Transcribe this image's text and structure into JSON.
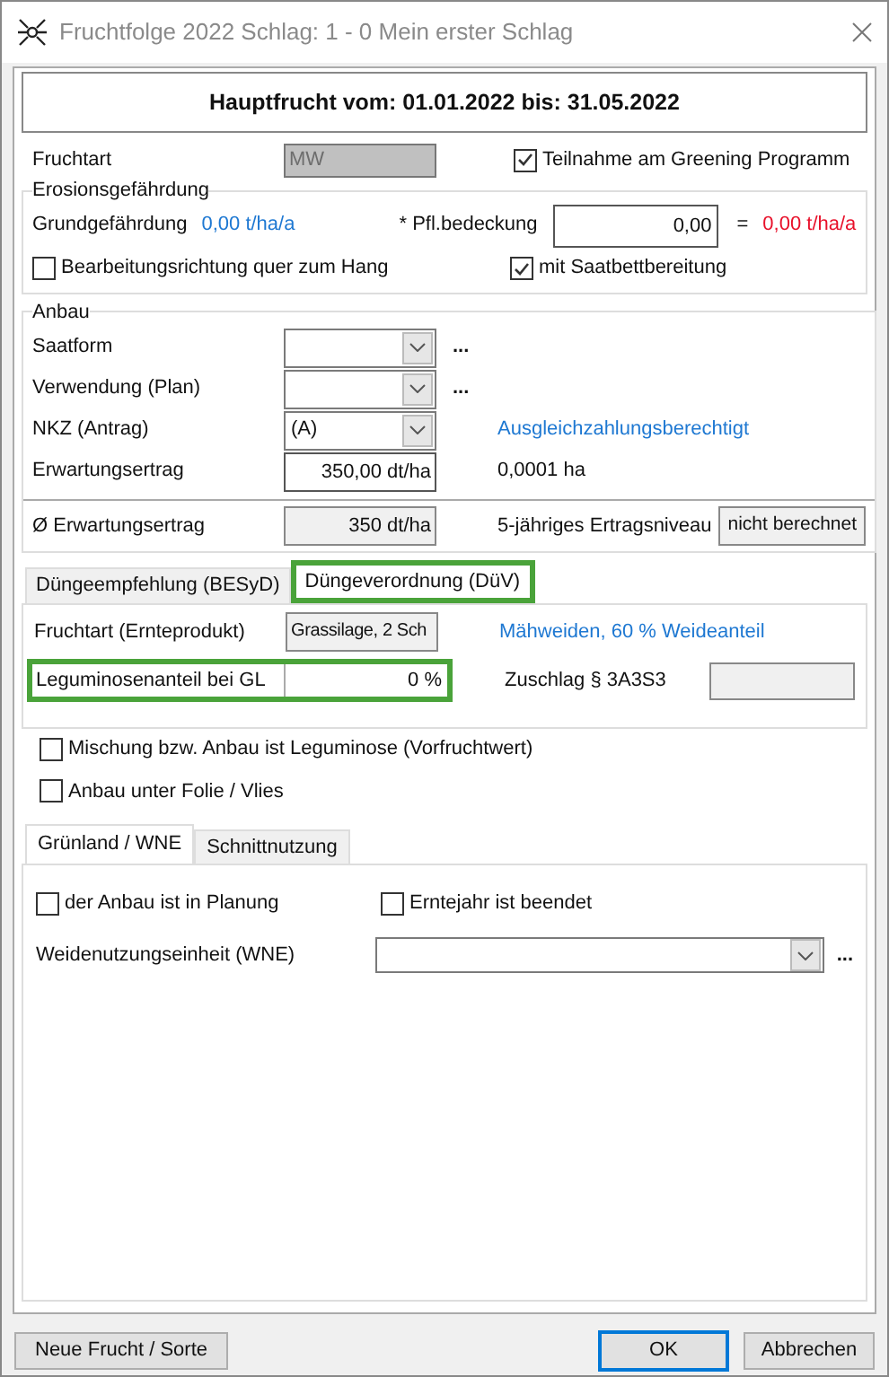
{
  "window": {
    "title": "Fruchtfolge 2022 Schlag: 1 - 0 Mein erster Schlag"
  },
  "header": "Hauptfrucht vom: 01.01.2022 bis: 31.05.2022",
  "fruchtart": {
    "label": "Fruchtart",
    "value": "MW",
    "disabled": true
  },
  "greening": {
    "label": "Teilnahme am Greening Programm",
    "checked": true
  },
  "erosion": {
    "legend": "Erosionsgefährdung",
    "grund_label": "Grundgefährdung",
    "grund_value": "0,00 t/ha/a",
    "pfl_label": "* Pfl.bedeckung",
    "pfl_value": "0,00",
    "equals": "=",
    "result": "0,00 t/ha/a",
    "checks": [
      {
        "label": "Bearbeitungsrichtung quer zum Hang",
        "checked": false
      },
      {
        "label": "mit Saatbettbereitung",
        "checked": true
      }
    ]
  },
  "anbau": {
    "legend": "Anbau",
    "rows": [
      {
        "kind": "combo",
        "label": "Saatform",
        "value": "",
        "extra": "..."
      },
      {
        "kind": "combo",
        "label": "Verwendung (Plan)",
        "value": "",
        "extra": "..."
      },
      {
        "kind": "combo",
        "label": "NKZ  (Antrag)",
        "value": "(A)",
        "note": "Ausgleichzahlungsberechtigt"
      },
      {
        "kind": "input",
        "label": "Erwartungsertrag",
        "value": "350,00 dt/ha",
        "info": "0,0001 ha"
      }
    ]
  },
  "average": {
    "label": "Ø Erwartungsertrag",
    "value": "350 dt/ha",
    "level_label": "5-jähriges Ertragsniveau",
    "level_button": "nicht berechnet"
  },
  "tabs": [
    {
      "label": "Düngeempfehlung (BESyD)",
      "selected": false,
      "highlighted": false
    },
    {
      "label": "Düngeverordnung (DüV)",
      "selected": true,
      "highlighted": true
    }
  ],
  "duev": {
    "crop_label": "Fruchtart (Ernteprodukt)",
    "crop_value": "Grassilage, 2 Sch",
    "crop_note": "Mähweiden, 60 % Weideanteil",
    "legume_label": "Leguminosenanteil bei GL",
    "legume_value": "0 %",
    "legume_highlighted": true,
    "surcharge_label": "Zuschlag § 3A3S3",
    "checks": [
      {
        "label": "Mischung bzw. Anbau ist Leguminose (Vorfruchtwert)",
        "checked": false
      },
      {
        "label": "Anbau unter Folie / Vlies",
        "checked": false
      }
    ]
  },
  "lower_tabs": [
    {
      "label": "Grünland / WNE",
      "selected": true
    },
    {
      "label": "Schnittnutzung",
      "selected": false
    }
  ],
  "grassland": {
    "checks": [
      {
        "label": "der Anbau ist in Planung",
        "checked": false
      },
      {
        "label": "Erntejahr ist beendet",
        "checked": false
      }
    ],
    "wne_label": "Weidenutzungseinheit (WNE)",
    "wne_extra": "..."
  },
  "buttons": {
    "new": "Neue Frucht / Sorte",
    "ok": "OK",
    "cancel": "Abbrechen"
  }
}
